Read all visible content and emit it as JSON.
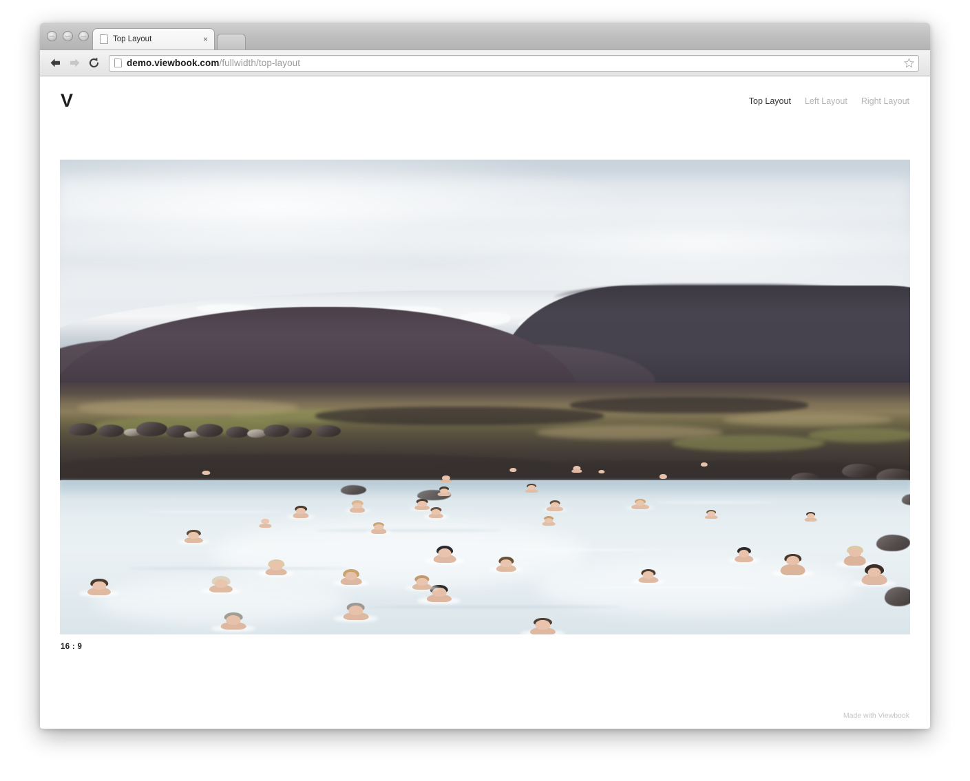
{
  "browser": {
    "traffic_lights": [
      "close",
      "minimize",
      "zoom"
    ],
    "tab": {
      "title": "Top Layout",
      "close_label": "×",
      "favicon": "document-icon"
    },
    "new_tab_label": "",
    "toolbar": {
      "back_label": "←",
      "forward_label": "→",
      "reload_label": "⟳",
      "url_host": "demo.viewbook.com",
      "url_path": "/fullwidth/top-layout",
      "url_full": "demo.viewbook.com/fullwidth/top-layout",
      "bookmark_label": "star-icon"
    }
  },
  "site": {
    "logo": "V",
    "nav": [
      {
        "label": "Top Layout",
        "active": true
      },
      {
        "label": "Left Layout",
        "active": false
      },
      {
        "label": "Right Layout",
        "active": false
      }
    ],
    "figure": {
      "caption": "16 : 9",
      "alt": "Bathers in a pale blue geothermal lagoon beneath dark volcanic hills and a snow-streaked ridge under overcast sky"
    },
    "footer": {
      "text": "Made with Viewbook"
    }
  },
  "colors": {
    "page_background": "#ffffff",
    "nav_active": "#333333",
    "nav_inactive": "#b4b4b4",
    "caption": "#1d1d1d",
    "footer": "#c3c3c3",
    "logo": "#1d1d1d",
    "water": "#e6eef1",
    "volcanic_rock": "#453b44",
    "sky": "#e2e7eb"
  }
}
